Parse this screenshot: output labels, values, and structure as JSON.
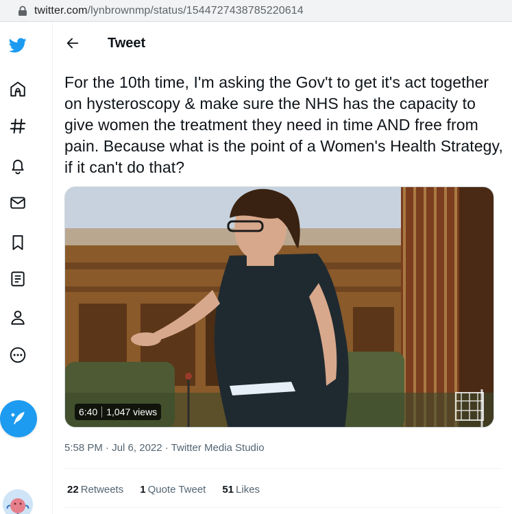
{
  "browser": {
    "url_host": "twitter.com",
    "url_path": "/lynbrownmp/status/1544727438785220614",
    "lock_icon": "lock-icon"
  },
  "nav": {
    "brand_color": "#1d9bf0",
    "items": [
      "twitter-logo-icon",
      "home-icon",
      "explore-hashtag-icon",
      "notifications-bell-icon",
      "messages-envelope-icon",
      "bookmarks-icon",
      "lists-icon",
      "profile-icon",
      "more-icon"
    ],
    "compose_icon": "compose-tweet-icon"
  },
  "header": {
    "back_icon": "back-arrow-icon",
    "title": "Tweet"
  },
  "tweet": {
    "text": "For the 10th time, I'm asking the Gov't to get it's act together on hysteroscopy & make sure the NHS has the capacity to give women the treatment they need in time AND free from pain. Because what is the point of a Women's Health Strategy, if it can't do that?",
    "video": {
      "duration": "6:40",
      "views": "1,047 views"
    },
    "time": "5:58 PM",
    "separator1": " · ",
    "date": "Jul 6, 2022",
    "separator2": " · ",
    "source": "Twitter Media Studio",
    "stats": {
      "retweets_count": "22",
      "retweets_label": "Retweets",
      "quotes_count": "1",
      "quotes_label": "Quote Tweet",
      "likes_count": "51",
      "likes_label": "Likes"
    }
  }
}
